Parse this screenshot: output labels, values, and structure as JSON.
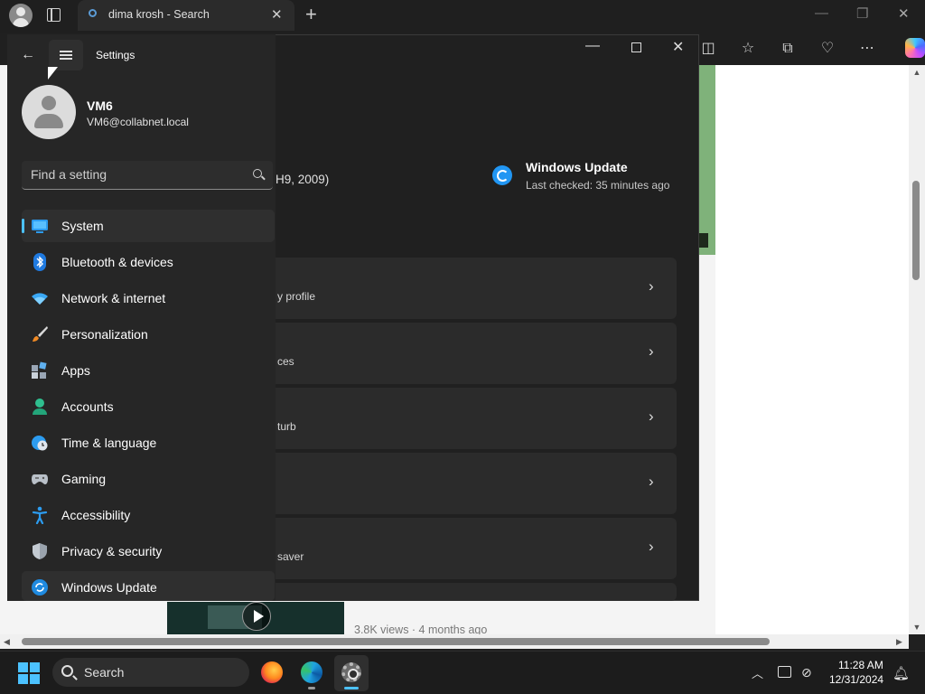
{
  "browser": {
    "tab_title": "dima krosh - Search",
    "video_meta": "3.8K views · 4 months ago"
  },
  "settings": {
    "title": "Settings",
    "user": {
      "name": "VM6",
      "email": "VM6@collabnet.local"
    },
    "search": {
      "placeholder": "Find a setting"
    },
    "nav": [
      {
        "label": "System",
        "icon": "system-icon",
        "selected": true
      },
      {
        "label": "Bluetooth & devices",
        "icon": "bluetooth-icon"
      },
      {
        "label": "Network & internet",
        "icon": "wifi-icon"
      },
      {
        "label": "Personalization",
        "icon": "brush-icon"
      },
      {
        "label": "Apps",
        "icon": "apps-icon"
      },
      {
        "label": "Accounts",
        "icon": "accounts-icon"
      },
      {
        "label": "Time & language",
        "icon": "globe-clock-icon"
      },
      {
        "label": "Gaming",
        "icon": "gamepad-icon"
      },
      {
        "label": "Accessibility",
        "icon": "accessibility-icon"
      },
      {
        "label": "Privacy & security",
        "icon": "shield-icon"
      },
      {
        "label": "Windows Update",
        "icon": "update-icon"
      }
    ],
    "os_version_fragment": "H9, 2009)",
    "windows_update": {
      "title": "Windows Update",
      "subtitle": "Last checked: 35 minutes ago"
    },
    "cards": [
      {
        "subtitle": "y profile"
      },
      {
        "subtitle": "ces"
      },
      {
        "subtitle": "turb"
      },
      {
        "subtitle": ""
      },
      {
        "subtitle": "saver"
      }
    ]
  },
  "taskbar": {
    "search_label": "Search",
    "time": "11:28 AM",
    "date": "12/31/2024"
  },
  "colors": {
    "accent": "#4cc2ff",
    "panel": "#202020",
    "card": "#2b2b2b"
  }
}
